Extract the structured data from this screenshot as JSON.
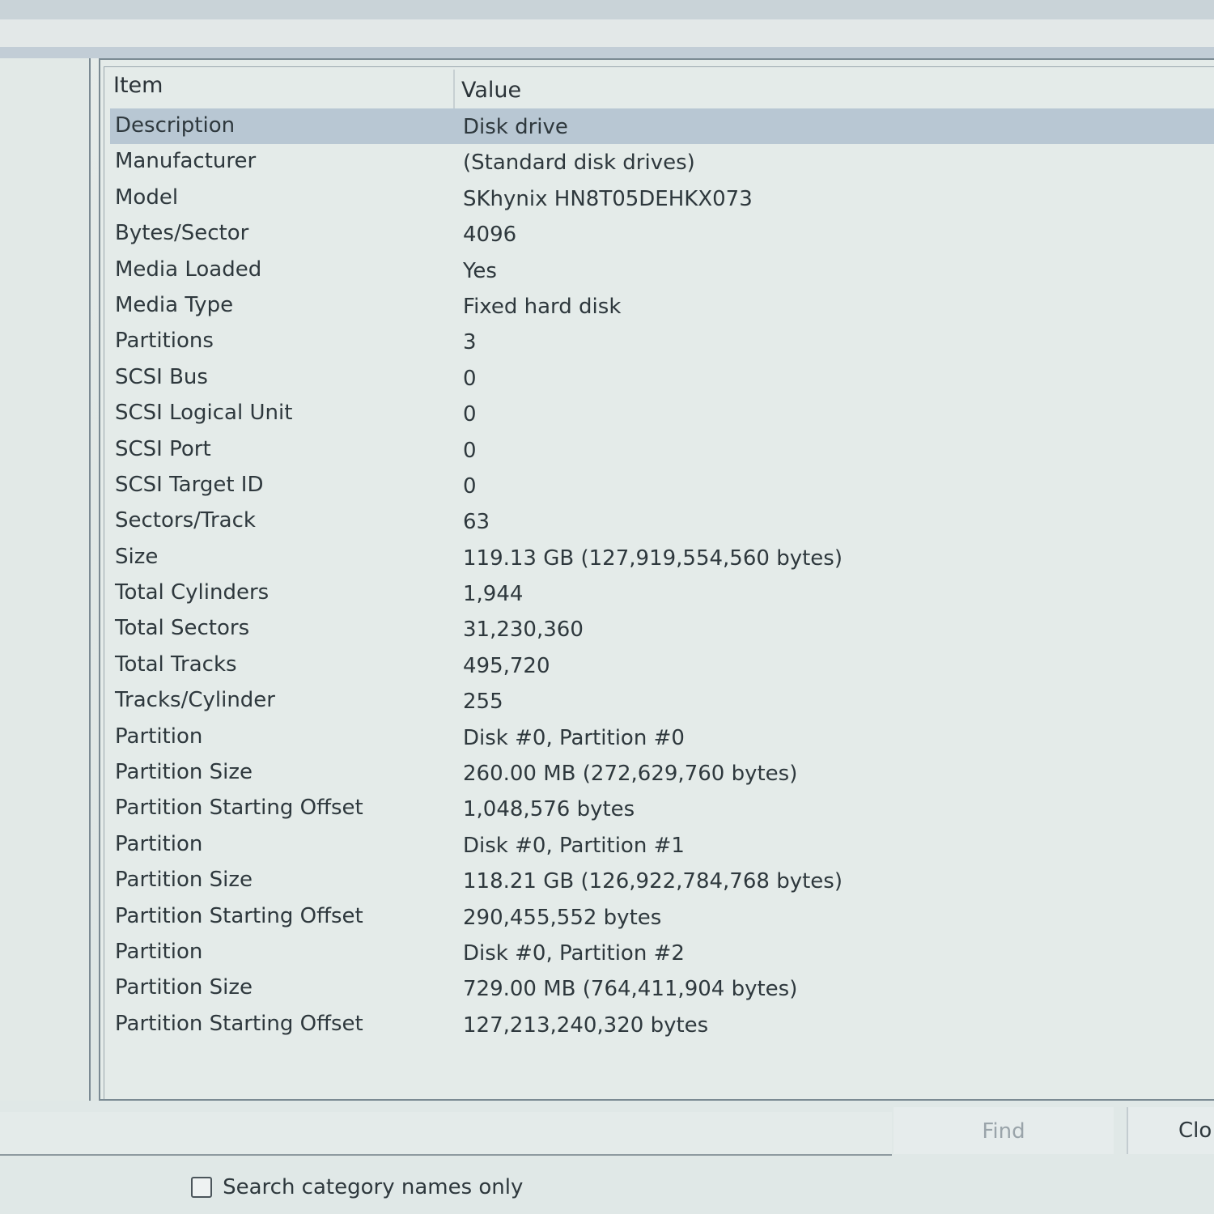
{
  "table": {
    "headers": {
      "item": "Item",
      "value": "Value"
    },
    "selected_row": 0,
    "rows": [
      {
        "item": "Description",
        "value": "Disk drive"
      },
      {
        "item": "Manufacturer",
        "value": "(Standard disk drives)"
      },
      {
        "item": "Model",
        "value": "SKhynix HN8T05DEHKX073"
      },
      {
        "item": "Bytes/Sector",
        "value": "4096"
      },
      {
        "item": "Media Loaded",
        "value": "Yes"
      },
      {
        "item": "Media Type",
        "value": "Fixed hard disk"
      },
      {
        "item": "Partitions",
        "value": "3"
      },
      {
        "item": "SCSI Bus",
        "value": "0"
      },
      {
        "item": "SCSI Logical Unit",
        "value": "0"
      },
      {
        "item": "SCSI Port",
        "value": "0"
      },
      {
        "item": "SCSI Target ID",
        "value": "0"
      },
      {
        "item": "Sectors/Track",
        "value": "63"
      },
      {
        "item": "Size",
        "value": "119.13 GB (127,919,554,560 bytes)"
      },
      {
        "item": "Total Cylinders",
        "value": "1,944"
      },
      {
        "item": "Total Sectors",
        "value": "31,230,360"
      },
      {
        "item": "Total Tracks",
        "value": "495,720"
      },
      {
        "item": "Tracks/Cylinder",
        "value": "255"
      },
      {
        "item": "Partition",
        "value": "Disk #0, Partition #0"
      },
      {
        "item": "Partition Size",
        "value": "260.00 MB (272,629,760 bytes)"
      },
      {
        "item": "Partition Starting Offset",
        "value": "1,048,576 bytes"
      },
      {
        "item": "Partition",
        "value": "Disk #0, Partition #1"
      },
      {
        "item": "Partition Size",
        "value": "118.21 GB (126,922,784,768 bytes)"
      },
      {
        "item": "Partition Starting Offset",
        "value": "290,455,552 bytes"
      },
      {
        "item": "Partition",
        "value": "Disk #0, Partition #2"
      },
      {
        "item": "Partition Size",
        "value": "729.00 MB (764,411,904 bytes)"
      },
      {
        "item": "Partition Starting Offset",
        "value": "127,213,240,320 bytes"
      }
    ]
  },
  "search": {
    "find_label": "Find",
    "close_label": "Clo",
    "checkbox_label": "Search category names only",
    "checkbox_checked": false,
    "input_value": ""
  }
}
